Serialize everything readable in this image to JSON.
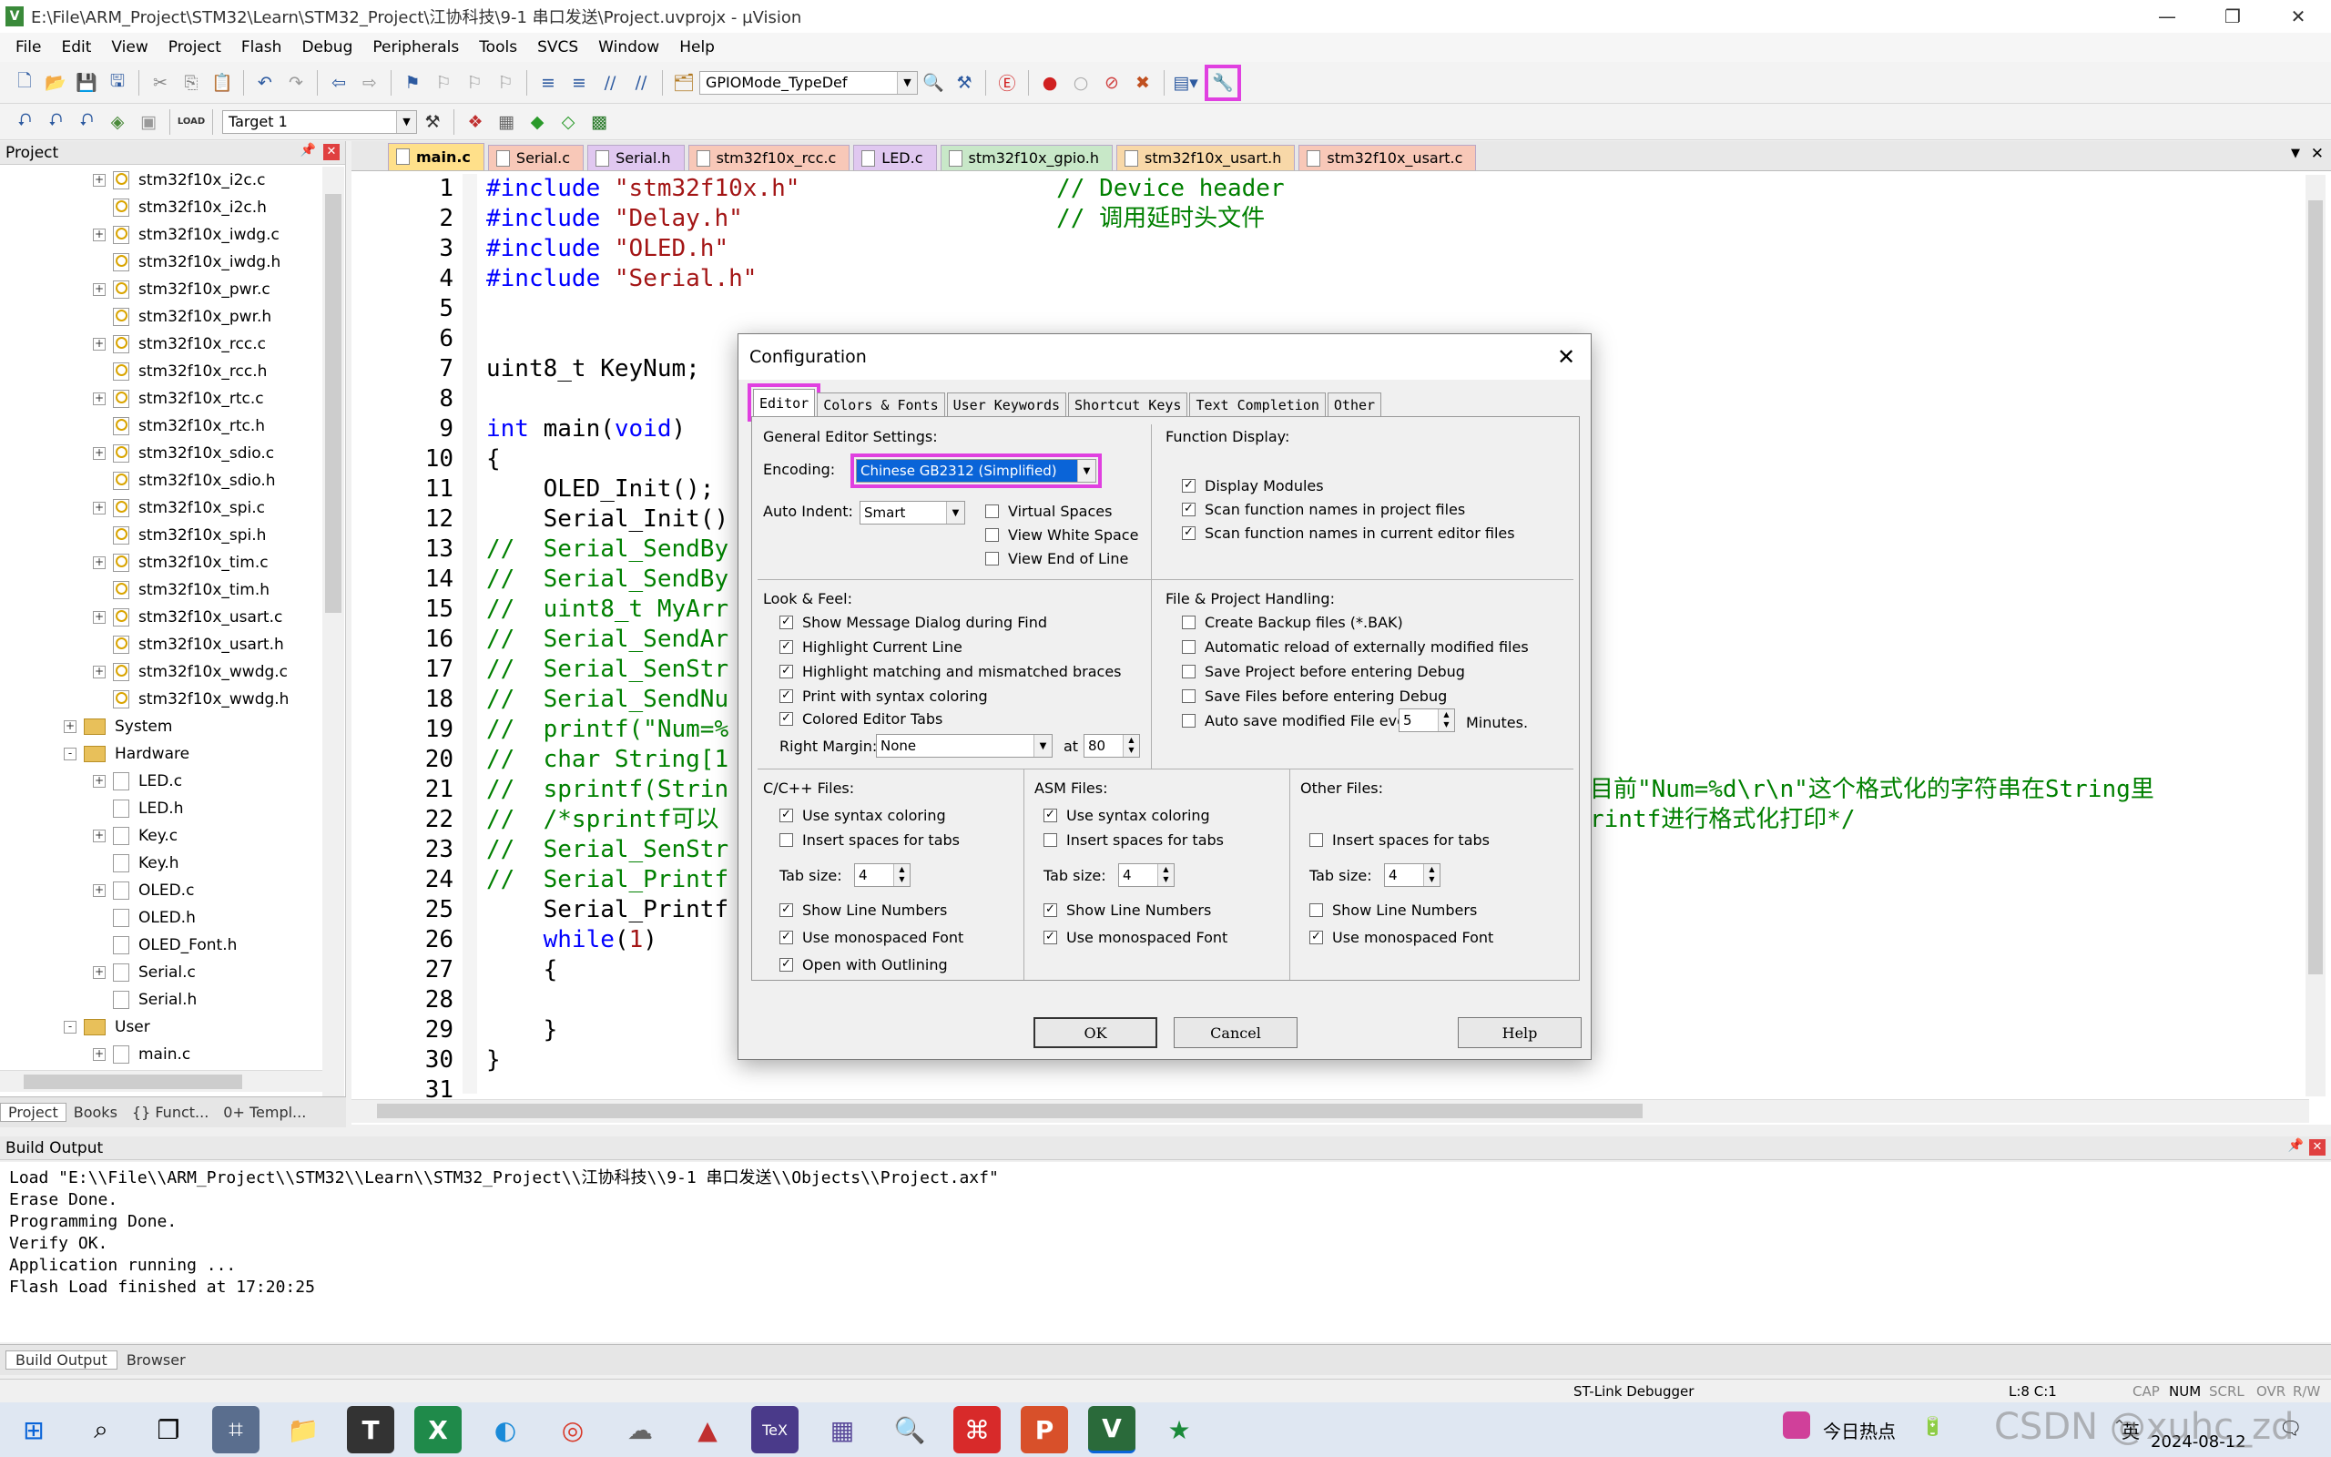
{
  "window": {
    "title": "E:\\File\\ARM_Project\\STM32\\Learn\\STM32_Project\\江协科技\\9-1 串口发送\\Project.uvprojx - µVision",
    "app_icon": "V"
  },
  "menu": [
    "File",
    "Edit",
    "View",
    "Project",
    "Flash",
    "Debug",
    "Peripherals",
    "Tools",
    "SVCS",
    "Window",
    "Help"
  ],
  "toolbar": {
    "find_combo": "GPIOMode_TypeDef",
    "target_combo": "Target 1",
    "load_label": "LOAD"
  },
  "project": {
    "header": "Project",
    "files": [
      "stm32f10x_i2c.c",
      "stm32f10x_i2c.h",
      "stm32f10x_iwdg.c",
      "stm32f10x_iwdg.h",
      "stm32f10x_pwr.c",
      "stm32f10x_pwr.h",
      "stm32f10x_rcc.c",
      "stm32f10x_rcc.h",
      "stm32f10x_rtc.c",
      "stm32f10x_rtc.h",
      "stm32f10x_sdio.c",
      "stm32f10x_sdio.h",
      "stm32f10x_spi.c",
      "stm32f10x_spi.h",
      "stm32f10x_tim.c",
      "stm32f10x_tim.h",
      "stm32f10x_usart.c",
      "stm32f10x_usart.h",
      "stm32f10x_wwdg.c",
      "stm32f10x_wwdg.h"
    ],
    "groups": {
      "system": "System",
      "hardware": "Hardware",
      "user": "User"
    },
    "hardware_files": [
      "LED.c",
      "LED.h",
      "Key.c",
      "Key.h",
      "OLED.c",
      "OLED.h",
      "OLED_Font.h",
      "Serial.c",
      "Serial.h"
    ],
    "user_files": [
      "main.c"
    ],
    "tabs": [
      "Project",
      "Books",
      "{} Funct...",
      "0+ Templ..."
    ]
  },
  "editor_tabs": [
    "main.c",
    "Serial.c",
    "Serial.h",
    "stm32f10x_rcc.c",
    "LED.c",
    "stm32f10x_gpio.h",
    "stm32f10x_usart.h",
    "stm32f10x_usart.c"
  ],
  "code_lines": [
    {
      "n": "1",
      "t": "#include \"stm32f10x.h\"                  // Device header",
      "c": "pp"
    },
    {
      "n": "2",
      "t": "#include \"Delay.h\"                      // 调用延时头文件",
      "c": "pp"
    },
    {
      "n": "3",
      "t": "#include \"OLED.h\"",
      "c": "pp"
    },
    {
      "n": "4",
      "t": "#include \"Serial.h\"",
      "c": "pp"
    },
    {
      "n": "5",
      "t": "",
      "c": ""
    },
    {
      "n": "6",
      "t": "",
      "c": ""
    },
    {
      "n": "7",
      "t": "uint8_t KeyNum;",
      "c": ""
    },
    {
      "n": "8",
      "t": "",
      "c": ""
    },
    {
      "n": "9",
      "t": "int main(void)",
      "c": "kw"
    },
    {
      "n": "10",
      "t": "{",
      "c": ""
    },
    {
      "n": "11",
      "t": "    OLED_Init();",
      "c": ""
    },
    {
      "n": "12",
      "t": "    Serial_Init()",
      "c": ""
    },
    {
      "n": "13",
      "t": "//  Serial_SendBy",
      "c": "cm"
    },
    {
      "n": "14",
      "t": "//  Serial_SendBy",
      "c": "cm"
    },
    {
      "n": "15",
      "t": "//  uint8_t MyArr",
      "c": "cm"
    },
    {
      "n": "16",
      "t": "//  Serial_SendAr",
      "c": "cm"
    },
    {
      "n": "17",
      "t": "//  Serial_SenStr",
      "c": "cm"
    },
    {
      "n": "18",
      "t": "//  Serial_SendNu",
      "c": "cm"
    },
    {
      "n": "19",
      "t": "//  printf(\"Num=%",
      "c": "cm"
    },
    {
      "n": "20",
      "t": "//  char String[1",
      "c": "cm"
    },
    {
      "n": "21",
      "t": "//  sprintf(Strin",
      "c": "cm"
    },
    {
      "n": "22",
      "t": "//  /*sprintf可以",
      "c": "cm"
    },
    {
      "n": "23",
      "t": "//  Serial_SenStr",
      "c": "cm"
    },
    {
      "n": "24",
      "t": "//  Serial_Printf",
      "c": "cm"
    },
    {
      "n": "25",
      "t": "    Serial_Printf",
      "c": ""
    },
    {
      "n": "26",
      "t": "    while(1)",
      "c": "kw2"
    },
    {
      "n": "27",
      "t": "    {",
      "c": ""
    },
    {
      "n": "28",
      "t": "",
      "c": ""
    },
    {
      "n": "29",
      "t": "    }",
      "c": ""
    },
    {
      "n": "30",
      "t": "}",
      "c": ""
    },
    {
      "n": "31",
      "t": "",
      "c": ""
    }
  ],
  "code_overflow": {
    "line21": "目前\"Num=%d\\r\\n\"这个格式化的字符串在String里",
    "line22": "rintf进行格式化打印*/"
  },
  "dialog": {
    "title": "Configuration",
    "tabs": [
      "Editor",
      "Colors & Fonts",
      "User Keywords",
      "Shortcut Keys",
      "Text Completion",
      "Other"
    ],
    "general": {
      "heading": "General Editor Settings:",
      "encoding_label": "Encoding:",
      "encoding_value": "Chinese GB2312 (Simplified)",
      "autoindent_label": "Auto Indent:",
      "autoindent_value": "Smart",
      "virtual_spaces": "Virtual Spaces",
      "view_white_space": "View White Space",
      "view_end_of_line": "View End of Line"
    },
    "function_display": {
      "heading": "Function Display:",
      "items": [
        "Display Modules",
        "Scan function names in project files",
        "Scan function names in current editor files"
      ]
    },
    "look": {
      "heading": "Look & Feel:",
      "items": [
        "Show Message Dialog during Find",
        "Highlight Current Line",
        "Highlight matching and mismatched braces",
        "Print with syntax coloring",
        "Colored Editor Tabs"
      ],
      "right_margin_label": "Right Margin:",
      "right_margin_value": "None",
      "at_label": "at",
      "at_value": "80"
    },
    "file_handling": {
      "heading": "File & Project Handling:",
      "items": [
        "Create Backup files (*.BAK)",
        "Automatic reload of externally modified files",
        "Save Project before entering Debug",
        "Save Files before entering Debug",
        "Auto save modified File every"
      ],
      "minutes_value": "5",
      "minutes_label": "Minutes."
    },
    "cfiles": {
      "heading": "C/C++ Files:",
      "syntax": "Use syntax coloring",
      "spaces": "Insert spaces for tabs",
      "tab_label": "Tab size:",
      "tab_value": "4",
      "line_numbers": "Show Line Numbers",
      "mono": "Use monospaced Font",
      "outlining": "Open with Outlining"
    },
    "asmfiles": {
      "heading": "ASM Files:",
      "syntax": "Use syntax coloring",
      "spaces": "Insert spaces for tabs",
      "tab_label": "Tab size:",
      "tab_value": "4",
      "line_numbers": "Show Line Numbers",
      "mono": "Use monospaced Font"
    },
    "otherfiles": {
      "heading": "Other Files:",
      "spaces": "Insert spaces for tabs",
      "tab_label": "Tab size:",
      "tab_value": "4",
      "line_numbers": "Show Line Numbers",
      "mono": "Use monospaced Font"
    },
    "buttons": {
      "ok": "OK",
      "cancel": "Cancel",
      "help": "Help"
    }
  },
  "build": {
    "header": "Build Output",
    "lines": [
      "Load \"E:\\\\File\\\\ARM_Project\\\\STM32\\\\Learn\\\\STM32_Project\\\\江协科技\\\\9-1 串口发送\\\\Objects\\\\Project.axf\"",
      "Erase Done.",
      "Programming Done.",
      "Verify OK.",
      "Application running ...",
      "Flash Load finished at 17:20:25"
    ],
    "tabs": [
      "Build Output",
      "Browser"
    ]
  },
  "status": {
    "debugger": "ST-Link Debugger",
    "position": "L:8 C:1",
    "caps": "CAP",
    "num": "NUM",
    "scrl": "SCRL",
    "ovr": "OVR",
    "rw": "R/W"
  },
  "taskbar": {
    "news": "今日热点",
    "ime": "英",
    "date": "2024-08-12",
    "watermark": "CSDN @xuhc_zd"
  },
  "colors": {
    "highlight": "#e040e0",
    "active_tab": "#ffe08a",
    "selection": "#0a64d8"
  }
}
